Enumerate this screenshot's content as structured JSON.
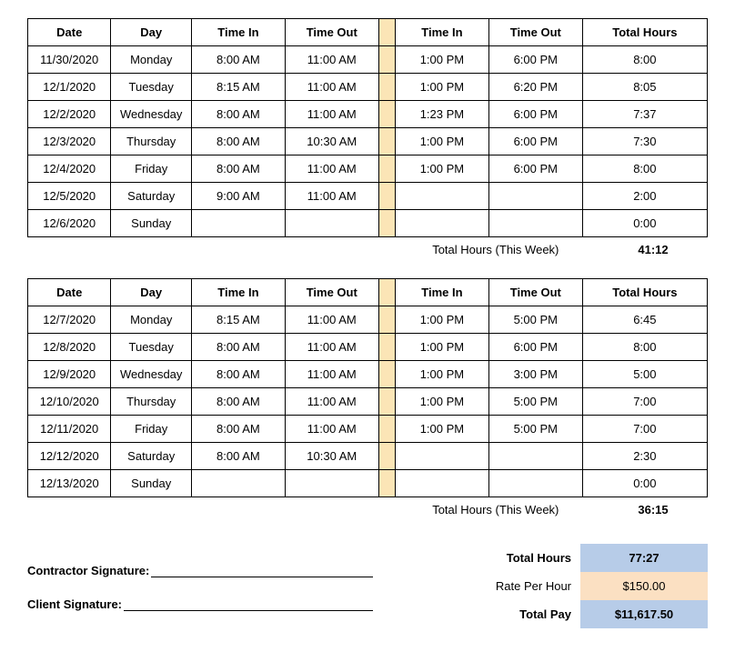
{
  "headers": {
    "date": "Date",
    "day": "Day",
    "time_in": "Time In",
    "time_out": "Time Out",
    "total_hours": "Total Hours"
  },
  "week1": {
    "rows": [
      {
        "date": "11/30/2020",
        "day": "Monday",
        "in1": "8:00 AM",
        "out1": "11:00 AM",
        "in2": "1:00 PM",
        "out2": "6:00 PM",
        "total": "8:00"
      },
      {
        "date": "12/1/2020",
        "day": "Tuesday",
        "in1": "8:15 AM",
        "out1": "11:00 AM",
        "in2": "1:00 PM",
        "out2": "6:20 PM",
        "total": "8:05"
      },
      {
        "date": "12/2/2020",
        "day": "Wednesday",
        "in1": "8:00 AM",
        "out1": "11:00 AM",
        "in2": "1:23 PM",
        "out2": "6:00 PM",
        "total": "7:37"
      },
      {
        "date": "12/3/2020",
        "day": "Thursday",
        "in1": "8:00 AM",
        "out1": "10:30 AM",
        "in2": "1:00 PM",
        "out2": "6:00 PM",
        "total": "7:30"
      },
      {
        "date": "12/4/2020",
        "day": "Friday",
        "in1": "8:00 AM",
        "out1": "11:00 AM",
        "in2": "1:00 PM",
        "out2": "6:00 PM",
        "total": "8:00"
      },
      {
        "date": "12/5/2020",
        "day": "Saturday",
        "in1": "9:00 AM",
        "out1": "11:00 AM",
        "in2": "",
        "out2": "",
        "total": "2:00"
      },
      {
        "date": "12/6/2020",
        "day": "Sunday",
        "in1": "",
        "out1": "",
        "in2": "",
        "out2": "",
        "total": "0:00"
      }
    ],
    "total_label": "Total Hours (This Week)",
    "total_value": "41:12"
  },
  "week2": {
    "rows": [
      {
        "date": "12/7/2020",
        "day": "Monday",
        "in1": "8:15 AM",
        "out1": "11:00 AM",
        "in2": "1:00 PM",
        "out2": "5:00 PM",
        "total": "6:45"
      },
      {
        "date": "12/8/2020",
        "day": "Tuesday",
        "in1": "8:00 AM",
        "out1": "11:00 AM",
        "in2": "1:00 PM",
        "out2": "6:00 PM",
        "total": "8:00"
      },
      {
        "date": "12/9/2020",
        "day": "Wednesday",
        "in1": "8:00 AM",
        "out1": "11:00 AM",
        "in2": "1:00 PM",
        "out2": "3:00 PM",
        "total": "5:00"
      },
      {
        "date": "12/10/2020",
        "day": "Thursday",
        "in1": "8:00 AM",
        "out1": "11:00 AM",
        "in2": "1:00 PM",
        "out2": "5:00 PM",
        "total": "7:00"
      },
      {
        "date": "12/11/2020",
        "day": "Friday",
        "in1": "8:00 AM",
        "out1": "11:00 AM",
        "in2": "1:00 PM",
        "out2": "5:00 PM",
        "total": "7:00"
      },
      {
        "date": "12/12/2020",
        "day": "Saturday",
        "in1": "8:00 AM",
        "out1": "10:30 AM",
        "in2": "",
        "out2": "",
        "total": "2:30"
      },
      {
        "date": "12/13/2020",
        "day": "Sunday",
        "in1": "",
        "out1": "",
        "in2": "",
        "out2": "",
        "total": "0:00"
      }
    ],
    "total_label": "Total Hours (This Week)",
    "total_value": "36:15"
  },
  "signatures": {
    "contractor": "Contractor Signature:",
    "client": "Client Signature:"
  },
  "summary": {
    "total_hours_label": "Total Hours",
    "total_hours_value": "77:27",
    "rate_label": "Rate Per Hour",
    "rate_value": "$150.00",
    "total_pay_label": "Total Pay",
    "total_pay_value": "$11,617.50"
  }
}
